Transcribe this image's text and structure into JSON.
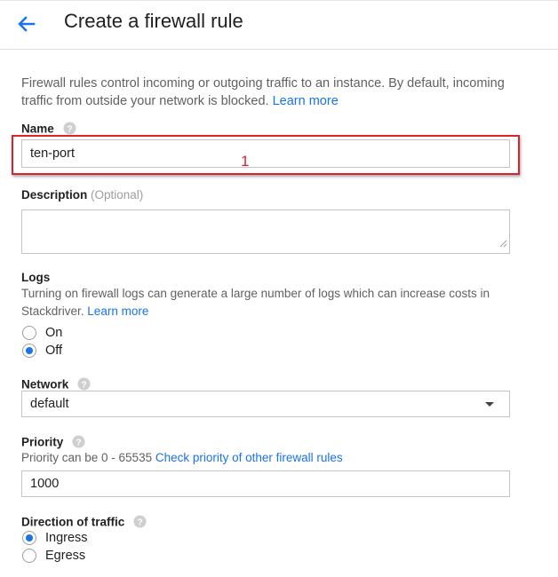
{
  "header": {
    "title": "Create a firewall rule"
  },
  "intro": {
    "text": "Firewall rules control incoming or outgoing traffic to an instance. By default, incoming traffic from outside your network is blocked.",
    "link": "Learn more"
  },
  "name_field": {
    "label": "Name",
    "value": "ten-port"
  },
  "annotation": {
    "marker": "1"
  },
  "description_field": {
    "label": "Description",
    "optional": "(Optional)",
    "value": ""
  },
  "logs": {
    "label": "Logs",
    "description": "Turning on firewall logs can generate a large number of logs which can increase costs in Stackdriver.",
    "link": "Learn more",
    "options": [
      "On",
      "Off"
    ],
    "selected": "Off"
  },
  "network": {
    "label": "Network",
    "value": "default"
  },
  "priority": {
    "label": "Priority",
    "hint": "Priority can be 0 - 65535",
    "link": "Check priority of other firewall rules",
    "value": "1000"
  },
  "direction": {
    "label": "Direction of traffic",
    "options": [
      "Ingress",
      "Egress"
    ],
    "selected": "Ingress"
  },
  "colors": {
    "accent": "#1a73e8",
    "highlight": "#d9232d"
  }
}
